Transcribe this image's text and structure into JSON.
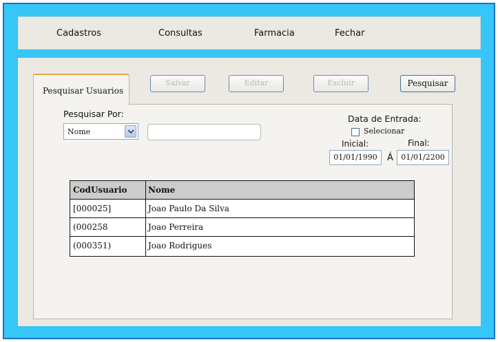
{
  "menu": {
    "items": [
      {
        "label": "Cadastros"
      },
      {
        "label": "Consultas"
      },
      {
        "label": "Farmacia"
      },
      {
        "label": "Fechar"
      }
    ]
  },
  "tab": {
    "label": "Pesquisar Usuarios"
  },
  "toolbar": {
    "salvar": "Salvar",
    "editar": "Editar",
    "excluir": "Excluir",
    "pesquisar": "Pesquisar"
  },
  "search": {
    "by_label": "Pesquisar Por:",
    "by_value": "Nome",
    "input_value": ""
  },
  "date_filter": {
    "title": "Data de Entrada:",
    "checkbox_label": "Selecionar",
    "checked": false,
    "initial_label": "Inicial:",
    "final_label": "Final:",
    "initial_value": "01/01/1990",
    "separator": "Á",
    "final_value": "01/01/2200"
  },
  "table": {
    "headers": [
      "CodUsuario",
      "Nome"
    ],
    "rows": [
      {
        "cod": "[000025]",
        "nome": "Joao Paulo Da Silva"
      },
      {
        "cod": "(000258",
        "nome": "Joao Perreira"
      },
      {
        "cod": "(000351)",
        "nome": "Joao Rodrigues"
      }
    ]
  },
  "colors": {
    "window_bg": "#37c6f8",
    "panel_bg": "#ece9e3",
    "tab_accent": "#e7a73f",
    "header_bg": "#cccccc"
  }
}
